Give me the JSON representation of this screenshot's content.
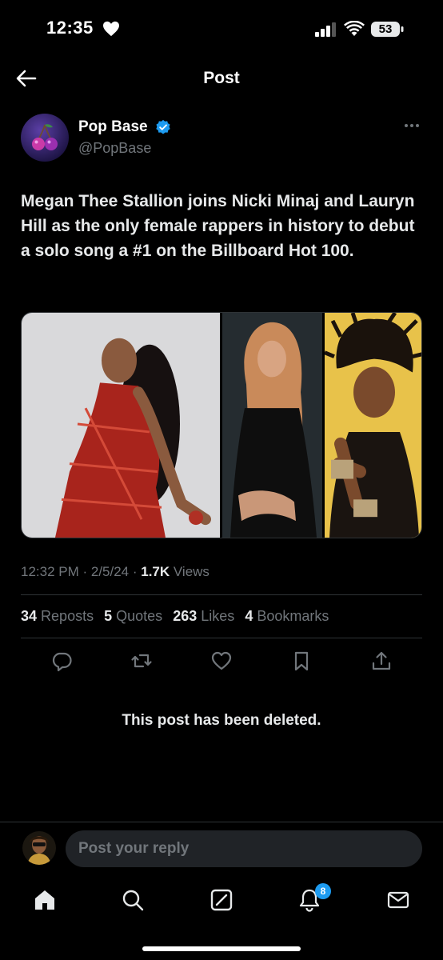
{
  "status_bar": {
    "time": "12:35",
    "battery": "53"
  },
  "header": {
    "title": "Post"
  },
  "post": {
    "author_name": "Pop Base",
    "author_handle": "@PopBase",
    "text": "Megan Thee Stallion joins Nicki Minaj and Lauryn Hill as the only female rappers in history to debut a solo song a #1 on the Billboard Hot 100.",
    "meta": {
      "time": "12:32 PM",
      "separator": " · ",
      "date": "2/5/24",
      "views_count": "1.7K",
      "views_label": " Views"
    },
    "stats": [
      {
        "count": "34",
        "label": "Reposts"
      },
      {
        "count": "5",
        "label": "Quotes"
      },
      {
        "count": "263",
        "label": "Likes"
      },
      {
        "count": "4",
        "label": "Bookmarks"
      }
    ],
    "actions": [
      "reply-icon",
      "repost-icon",
      "like-icon",
      "bookmark-icon",
      "share-icon"
    ]
  },
  "deleted_notice": "This post has been deleted.",
  "reply": {
    "placeholder": "Post your reply"
  },
  "tabs": [
    "home-icon",
    "search-icon",
    "grok-icon",
    "notifications-icon",
    "messages-icon"
  ],
  "notifications_badge": "8",
  "colors": {
    "background": "#000000",
    "accent": "#1d9bf0",
    "text": "#e7e9ea",
    "muted": "#71767b",
    "divider": "#2f3336"
  }
}
